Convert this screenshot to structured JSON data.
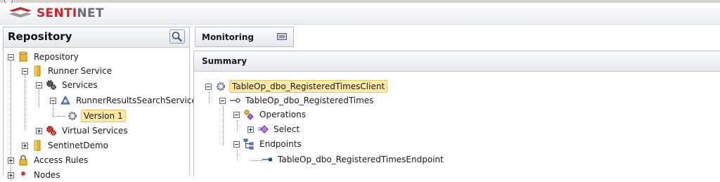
{
  "app": {
    "brand_prefix": "SENTI",
    "brand_suffix": "NET"
  },
  "repository_panel": {
    "title": "Repository",
    "tree": [
      {
        "label": "Repository"
      },
      {
        "label": "Runner Service"
      },
      {
        "label": "Services"
      },
      {
        "label": "RunnerResultsSearchService"
      },
      {
        "label": "Version 1",
        "selected": true
      },
      {
        "label": "Virtual Services"
      },
      {
        "label": "SentinetDemo"
      },
      {
        "label": "Access Rules"
      },
      {
        "label": "Nodes"
      }
    ]
  },
  "monitoring_tab": {
    "label": "Monitoring"
  },
  "summary_panel": {
    "title": "Summary",
    "tree": [
      {
        "label": "TableOp_dbo_RegisteredTimesClient",
        "selected": true
      },
      {
        "label": "TableOp_dbo_RegisteredTimes"
      },
      {
        "label": "Operations"
      },
      {
        "label": "Select"
      },
      {
        "label": "Endpoints"
      },
      {
        "label": "TableOp_dbo_RegisteredTimesEndpoint"
      }
    ]
  },
  "colors": {
    "brand_red": "#c8262b",
    "selection": "#fde9a5",
    "folder": "#e8b830"
  }
}
